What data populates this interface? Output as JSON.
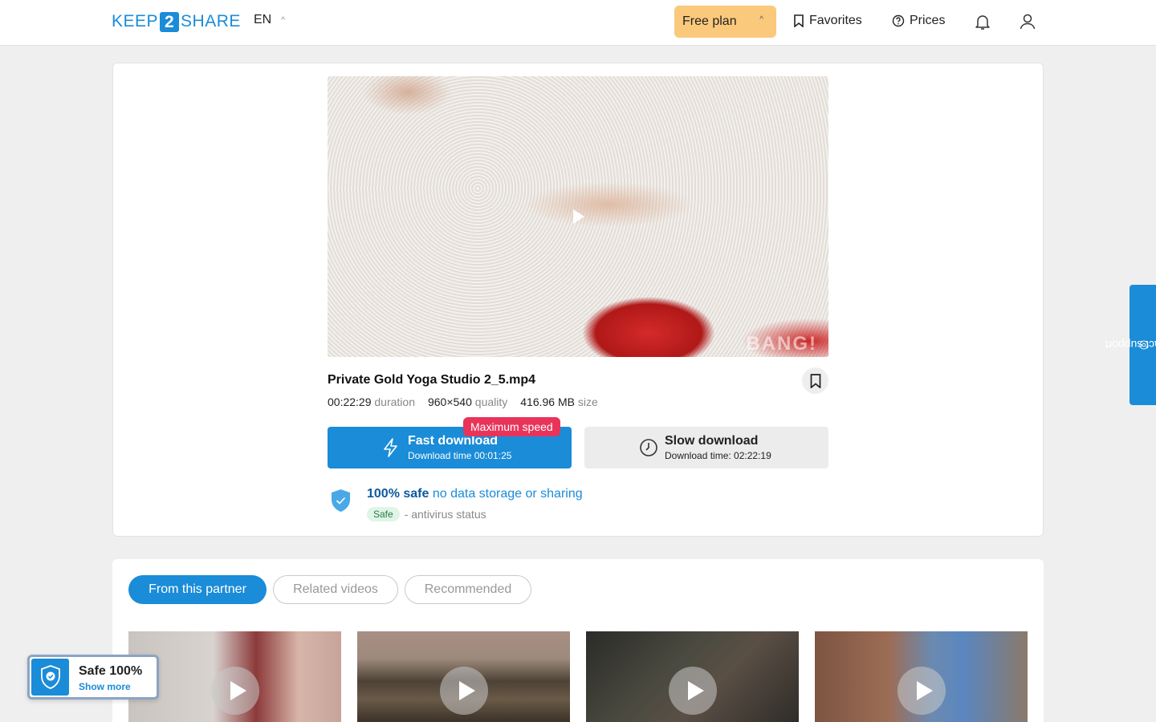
{
  "header": {
    "logo_left": "KEEP",
    "logo_num": "2",
    "logo_right": "SHARE",
    "language": "EN",
    "plan_label": "Free plan",
    "favorites_label": "Favorites",
    "prices_label": "Prices"
  },
  "file": {
    "name": "Private Gold Yoga Studio 2_5.mp4",
    "duration_value": "00:22:29",
    "duration_label": "duration",
    "quality_value": "960×540",
    "quality_label": "quality",
    "size_value": "416.96 MB",
    "size_label": "size",
    "watermark": "BANG!"
  },
  "download": {
    "badge": "Maximum speed",
    "fast_title": "Fast download",
    "fast_time": "Download time 00:01:25",
    "slow_title": "Slow download",
    "slow_time": "Download time: 02:22:19"
  },
  "safety": {
    "headline": "100% safe",
    "sub": "no data storage or sharing",
    "status_badge": "Safe",
    "status_text": "- antivirus status"
  },
  "tabs": [
    {
      "label": "From this partner",
      "active": true
    },
    {
      "label": "Related videos",
      "active": false
    },
    {
      "label": "Recommended",
      "active": false
    }
  ],
  "widget": {
    "title": "Safe 100%",
    "link": "Show more"
  },
  "support_label": "contact support",
  "colors": {
    "accent": "#1a8cd8",
    "plan_bg": "#fbc97c",
    "badge_red": "#e8345a"
  }
}
